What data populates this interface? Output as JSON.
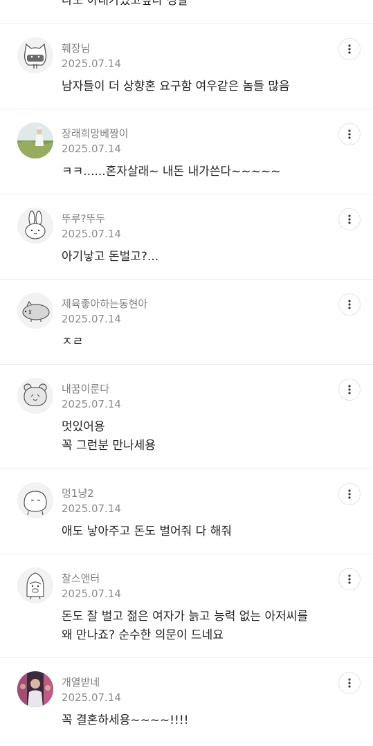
{
  "top_partial_text": "나도 아내가있고싶다 성발",
  "more_icon": "more-vertical-icon",
  "comments": [
    {
      "nickname": "훼장님",
      "date": "2025.07.14",
      "lines": [
        "남자들이 더 상향혼 요구함 여우같은 놈들 많음"
      ],
      "avatar": "cat-doodle"
    },
    {
      "nickname": "장래희망베짱이",
      "date": "2025.07.14",
      "lines": [
        "ㅋㅋ......혼자살래~ 내돈 내가쓴다~~~~~"
      ],
      "avatar": "photo-person-field"
    },
    {
      "nickname": "뚜루?뚜두",
      "date": "2025.07.14",
      "lines": [
        "아기낳고 돈벌고?..."
      ],
      "avatar": "bunny-doodle"
    },
    {
      "nickname": "제육좋아하는동현아",
      "date": "2025.07.14",
      "lines": [
        "ㅈㄹ"
      ],
      "avatar": "pig-doodle"
    },
    {
      "nickname": "내꿈이룬다",
      "date": "2025.07.14",
      "lines": [
        "멋있어용",
        "꼭 그런분 만나세용"
      ],
      "avatar": "bear-doodle"
    },
    {
      "nickname": "멍1냥2",
      "date": "2025.07.14",
      "lines": [
        "애도 낳아주고 돈도 벌어줘 다 해줘"
      ],
      "avatar": "blob-doodle"
    },
    {
      "nickname": "찰스앤터",
      "date": "2025.07.14",
      "lines": [
        "돈도 잘 벌고 젊은 여자가 늙고 능력 없는 아저씨를",
        "왜 만나죠? 순수한 의문이 드네요"
      ],
      "avatar": "penguin-doodle"
    },
    {
      "nickname": "개열받네",
      "date": "2025.07.14",
      "lines": [
        "꼭 결혼하세용~~~~!!!!"
      ],
      "avatar": "photo-crowd"
    }
  ]
}
